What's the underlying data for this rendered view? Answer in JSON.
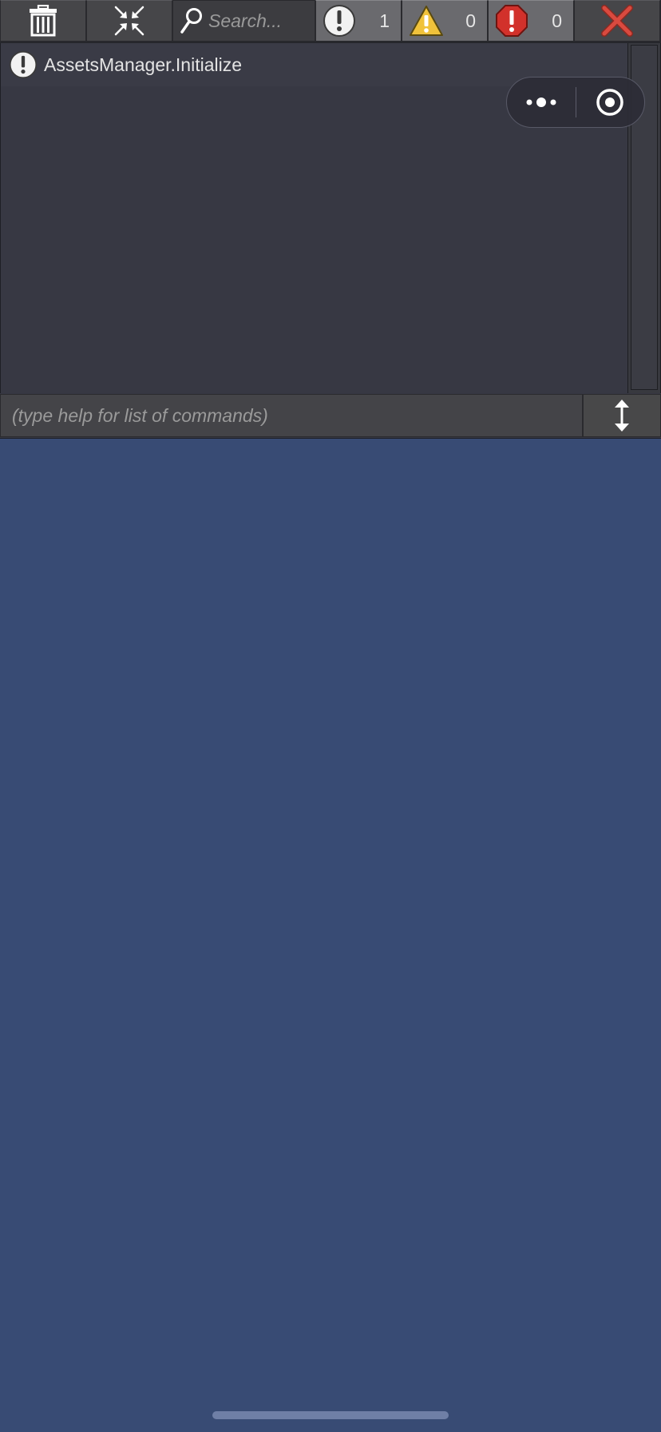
{
  "toolbar": {
    "clear_icon": "trash-icon",
    "collapse_icon": "collapse-arrows-icon",
    "search": {
      "placeholder": "Search...",
      "value": "",
      "icon": "search-icon"
    },
    "filters": [
      {
        "type": "info",
        "icon": "info-exclamation-icon",
        "count": "1"
      },
      {
        "type": "warning",
        "icon": "warning-triangle-icon",
        "count": "0"
      },
      {
        "type": "error",
        "icon": "error-octagon-icon",
        "count": "0"
      }
    ],
    "close_icon": "close-x-icon"
  },
  "log": {
    "entries": [
      {
        "level": "info",
        "text": "AssetsManager.Initialize"
      }
    ]
  },
  "command": {
    "placeholder": "(type help for list of commands)",
    "value": "",
    "resize_icon": "vertical-resize-icon"
  },
  "capsule": {
    "more_icon": "more-dots-icon",
    "close_icon": "target-circle-icon"
  },
  "colors": {
    "page_background": "#384b74",
    "console_background": "#373843",
    "toolbar_button": "#464649",
    "filter_button": "#6a6a6e",
    "warning_yellow": "#f0c23b",
    "error_red": "#d2312b",
    "close_red": "#d94a3f"
  }
}
